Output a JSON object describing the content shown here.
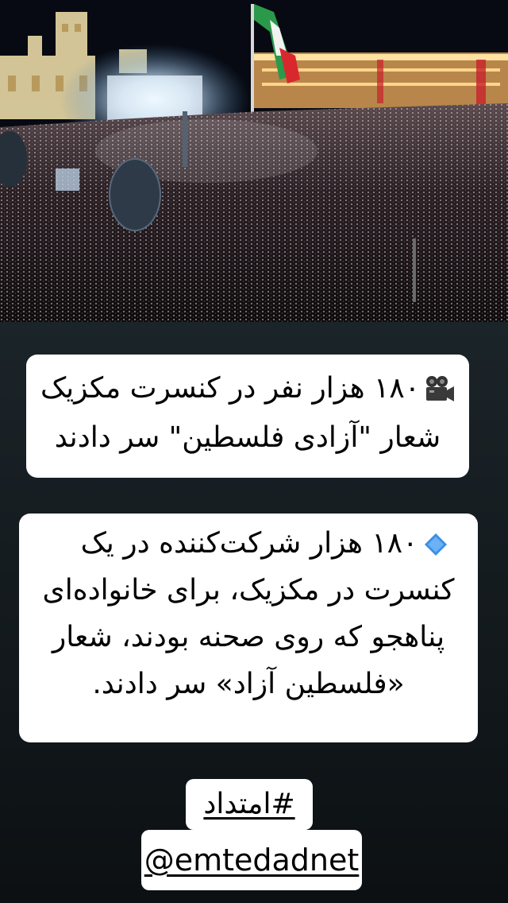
{
  "photo": {
    "icon": "concert-crowd-photo",
    "description_colors": {
      "sky": "#070a12",
      "crowd": "#1a1418",
      "lights": "#e8f4ff",
      "flag_green": "#1f7a3a",
      "flag_red": "#c8202a"
    }
  },
  "title": {
    "icon": "movie-camera-icon",
    "line1": "۱۸۰ هزار نفر در کنسرت مکزیک",
    "line2": "شعار \"آزادی فلسطین\" سر دادند"
  },
  "body": {
    "icon": "blue-diamond-icon",
    "line1": "۱۸۰ هزار شرکت‌کننده در یک",
    "line2": "کنسرت در مکزیک، برای خانواده‌ای",
    "line3": "پناهجو که روی صحنه بودند، شعار",
    "line4": "«فلسطین آزاد» سر دادند."
  },
  "hashtag": "#امتداد",
  "handle": "@emtedadnet",
  "colors": {
    "card": "#ffffff",
    "background": "#141b1f",
    "diamond": "#3a8ee6",
    "text": "#000000"
  }
}
